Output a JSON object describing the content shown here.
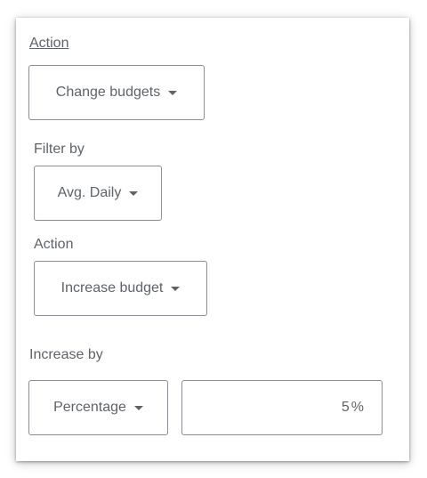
{
  "action_section": {
    "label": "Action",
    "dropdown_value": "Change budgets"
  },
  "filter_section": {
    "label": "Filter by",
    "dropdown_value": "Avg. Daily"
  },
  "budget_action_section": {
    "label": "Action",
    "dropdown_value": "Increase budget"
  },
  "increase_section": {
    "label": "Increase by",
    "type_value": "Percentage",
    "amount_value": "5",
    "amount_unit": "%"
  },
  "icons": {
    "dropdown": "caret-down-icon"
  },
  "colors": {
    "text": "#5f6368",
    "border": "#8a8d91"
  }
}
